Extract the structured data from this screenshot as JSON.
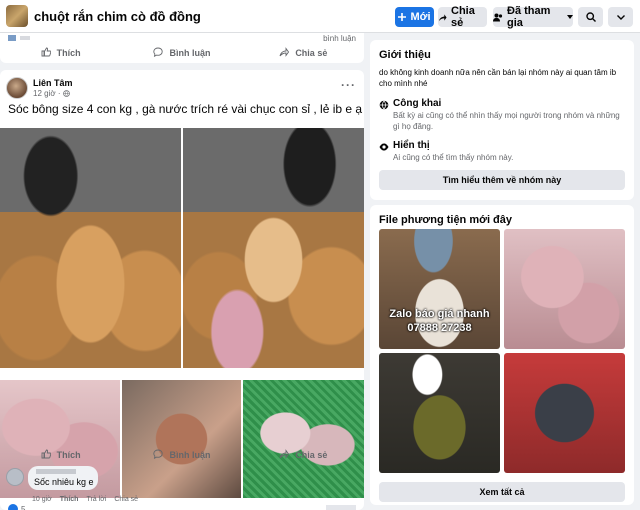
{
  "header": {
    "group_name": "chuột rắn chim cò đồ đồng",
    "new_label": "Mới",
    "share_label": "Chia sẻ",
    "joined_label": "Đã tham gia"
  },
  "prev_post": {
    "time": "bình luận",
    "actions": {
      "like": "Thích",
      "comment": "Bình luận",
      "share": "Chia sẻ"
    }
  },
  "post": {
    "author": "Liên Tâm",
    "time": "12 giờ ·",
    "text": "Sóc bông size 4 con kg , gà nước trích ré vài chục con sỉ , lẻ ib e ạ",
    "reaction_count": "5",
    "actions": {
      "like": "Thích",
      "comment": "Bình luận",
      "share": "Chia sẻ"
    },
    "comment": {
      "text": "Sốc nhiêu kg e",
      "time": "10 giờ",
      "like": "Thích",
      "reply": "Trả lời",
      "share": "Chia sẻ"
    }
  },
  "about": {
    "title": "Giới thiệu",
    "description": "do không kinh doanh nữa nên cần bán lại nhóm này ai quan tâm ib cho mình nhé",
    "public_title": "Công khai",
    "public_desc": "Bất kỳ ai cũng có thể nhìn thấy mọi người trong nhóm và những gì họ đăng.",
    "visible_title": "Hiển thị",
    "visible_desc": "Ai cũng có thể tìm thấy nhóm này.",
    "learn_more": "Tìm hiểu thêm về nhóm này"
  },
  "media": {
    "title": "File phương tiện mới đây",
    "watermark_line1": "Zalo báo giá nhanh",
    "watermark_line2": "07888 27238",
    "see_all": "Xem tất cả"
  },
  "colors": {
    "primary_blue": "#1b74e4",
    "page_bg": "#f0f2f5",
    "button_gray": "#e4e6eb",
    "secondary_text": "#65676b"
  }
}
